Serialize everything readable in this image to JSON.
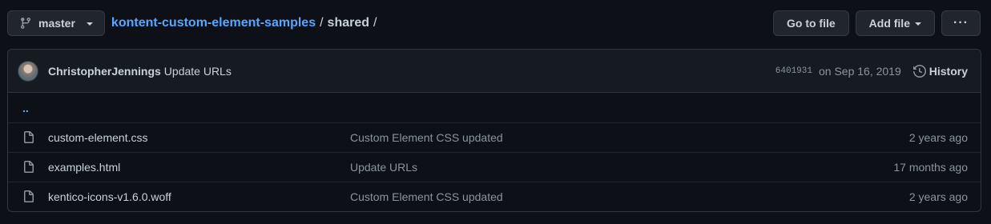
{
  "branch": {
    "label": "master"
  },
  "breadcrumb": {
    "repo": "kontent-custom-element-samples",
    "sep1": "/",
    "dir": "shared",
    "sep2": "/"
  },
  "actions": {
    "go_to_file": "Go to file",
    "add_file": "Add file",
    "more": "···"
  },
  "commit": {
    "author": "ChristopherJennings",
    "message": "Update URLs",
    "sha": "6401931",
    "date": "on Sep 16, 2019",
    "history_label": "History"
  },
  "updir": {
    "label": ".."
  },
  "files": [
    {
      "name": "custom-element.css",
      "message": "Custom Element CSS updated",
      "age": "2 years ago"
    },
    {
      "name": "examples.html",
      "message": "Update URLs",
      "age": "17 months ago"
    },
    {
      "name": "kentico-icons-v1.6.0.woff",
      "message": "Custom Element CSS updated",
      "age": "2 years ago"
    }
  ],
  "colors": {
    "background": "#0d1117",
    "link": "#58a6ff",
    "muted": "#8b949e",
    "border": "#30363d"
  }
}
